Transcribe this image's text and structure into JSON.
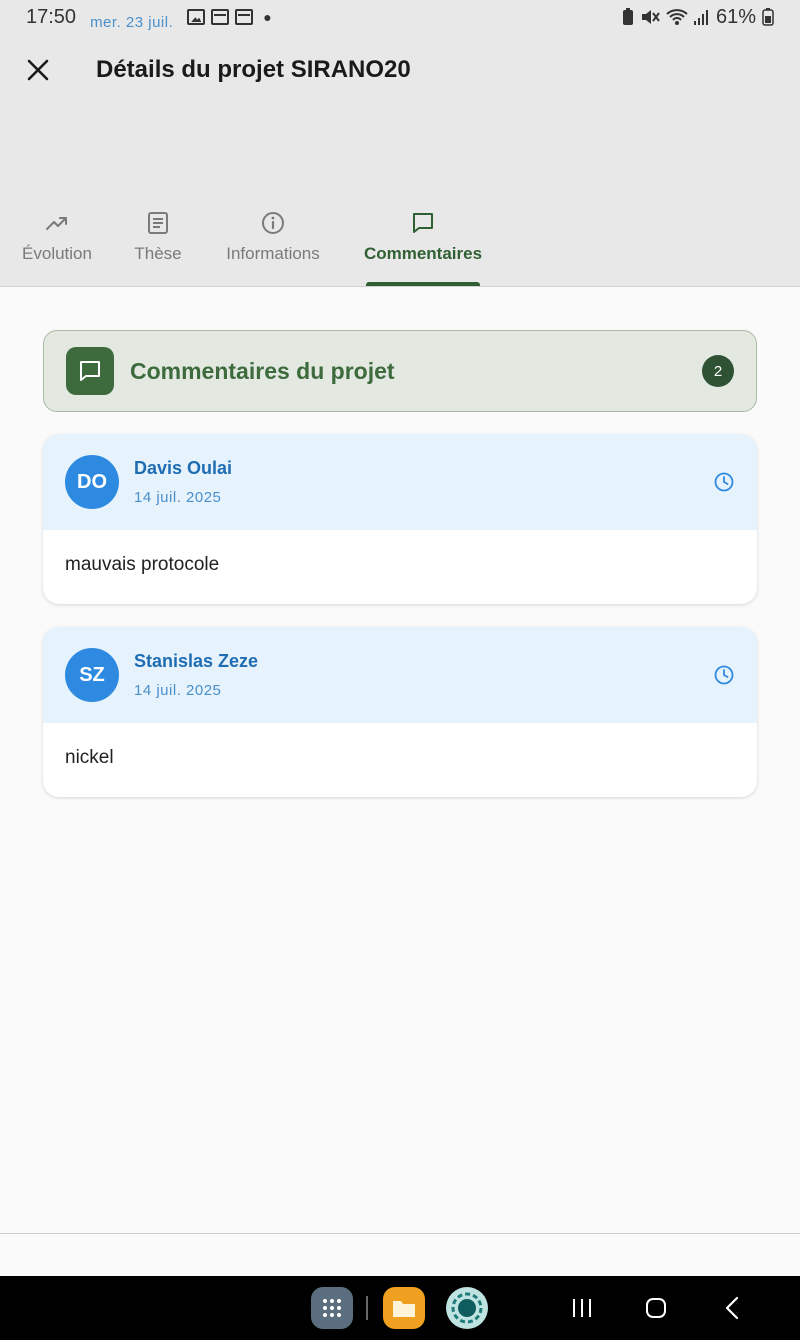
{
  "status_bar": {
    "time": "17:50",
    "date": "mer. 23 juil.",
    "battery": "61%",
    "icons": [
      "image-icon",
      "calendar-icon",
      "calendar-icon",
      "dot-icon",
      "battery-saver-icon",
      "mute-icon",
      "wifi-icon",
      "signal-icon",
      "battery-icon"
    ]
  },
  "header": {
    "title": "Détails du projet SIRANO20",
    "close_icon": "close-icon"
  },
  "tabs": [
    {
      "label": "Évolution",
      "icon": "trend-icon",
      "active": false
    },
    {
      "label": "Thèse",
      "icon": "document-icon",
      "active": false
    },
    {
      "label": "Informations",
      "icon": "info-icon",
      "active": false
    },
    {
      "label": "Commentaires",
      "icon": "comment-icon",
      "active": true
    }
  ],
  "section": {
    "title": "Commentaires du projet",
    "count": "2",
    "icon": "comment-icon"
  },
  "comments": [
    {
      "initials": "DO",
      "author": "Davis Oulai",
      "date": "14 juil. 2025",
      "text": "mauvais protocole"
    },
    {
      "initials": "SZ",
      "author": "Stanislas Zeze",
      "date": "14 juil. 2025",
      "text": "nickel"
    }
  ],
  "colors": {
    "accent_green": "#3d6b3e",
    "avatar_blue": "#2e8ae0",
    "author_blue": "#1f6db3",
    "comment_header_bg": "#e6f2fc"
  },
  "nav": {
    "apps": [
      "app-drawer-icon",
      "files-app-icon",
      "camera-app-icon"
    ],
    "buttons": [
      "recent-apps-icon",
      "home-icon",
      "back-icon"
    ]
  }
}
